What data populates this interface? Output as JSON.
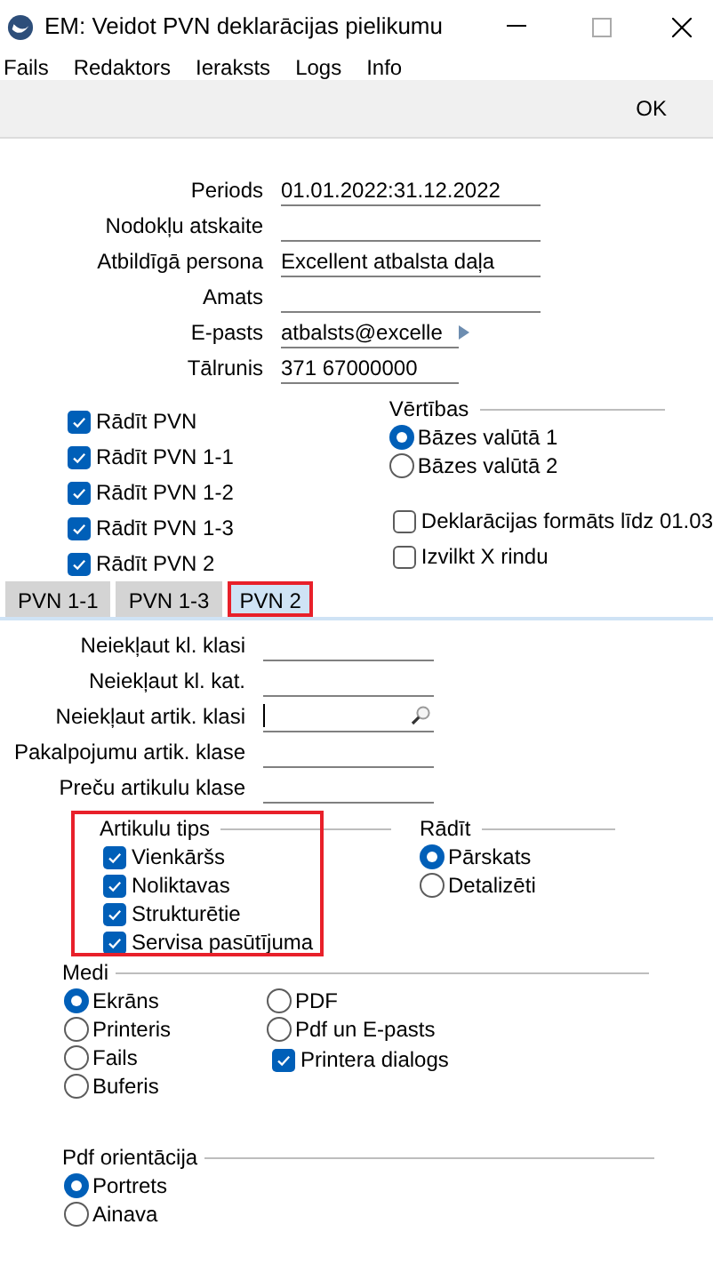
{
  "window": {
    "title": "EM: Veidot PVN deklarācijas pielikumu"
  },
  "menu": [
    "Fails",
    "Redaktors",
    "Ieraksts",
    "Logs",
    "Info"
  ],
  "toolbar": {
    "ok": "OK"
  },
  "fields": [
    {
      "label": "Periods",
      "value": "01.01.2022:31.12.2022",
      "kind": "text"
    },
    {
      "label": "Nodokļu atskaite",
      "kind": "text"
    },
    {
      "label": "Atbildīgā persona",
      "value": "Excellent atbalsta daļa",
      "kind": "text"
    },
    {
      "label": "Amats",
      "kind": "text"
    },
    {
      "label": "E-pasts",
      "value": "atbalsts@excelle",
      "kind": "email"
    },
    {
      "label": "Tālrunis",
      "value": "371 67000000",
      "kind": "phone"
    }
  ],
  "show_checks": [
    {
      "label": "Rādīt PVN",
      "checked": true
    },
    {
      "label": "Rādīt PVN 1-1",
      "checked": true
    },
    {
      "label": "Rādīt PVN 1-2",
      "checked": true
    },
    {
      "label": "Rādīt PVN 1-3",
      "checked": true
    },
    {
      "label": "Rādīt PVN 2",
      "checked": true
    }
  ],
  "values": {
    "label": "Vērtības",
    "options": [
      {
        "label": "Bāzes valūtā 1",
        "selected": true
      },
      {
        "label": "Bāzes valūtā 2",
        "selected": false
      }
    ]
  },
  "options": [
    {
      "label": "Deklarācijas formāts līdz 01.03",
      "checked": false
    },
    {
      "label": "Izvilkt X rindu",
      "checked": false
    }
  ],
  "tabs": [
    {
      "label": "PVN 1-1",
      "selected": false,
      "annotated": false
    },
    {
      "label": "PVN 1-3",
      "selected": false,
      "annotated": false
    },
    {
      "label": "PVN 2",
      "selected": true,
      "annotated": true
    }
  ],
  "tab_fields": [
    {
      "label": "Neiekļaut kl. klasi",
      "kind": "text"
    },
    {
      "label": "Neiekļaut kl. kat.",
      "kind": "text"
    },
    {
      "label": "Neiekļaut artik. klasi",
      "kind": "lookup"
    },
    {
      "label": "Pakalpojumu artik. klase",
      "kind": "text"
    },
    {
      "label": "Preču artikulu klase",
      "kind": "text"
    }
  ],
  "article_types": {
    "label": "Artikulu tips",
    "annotated": true,
    "items": [
      {
        "label": "Vienkāršs",
        "checked": true
      },
      {
        "label": "Noliktavas",
        "checked": true
      },
      {
        "label": "Strukturētie",
        "checked": true
      },
      {
        "label": "Servisa pasūtījuma",
        "checked": true
      }
    ]
  },
  "show": {
    "label": "Rādīt",
    "options": [
      {
        "label": "Pārskats",
        "selected": true
      },
      {
        "label": "Detalizēti",
        "selected": false
      }
    ]
  },
  "media": {
    "label": "Medi",
    "options": [
      {
        "label": "Ekrāns",
        "selected": true
      },
      {
        "label": "Printeris",
        "selected": false
      },
      {
        "label": "Fails",
        "selected": false
      },
      {
        "label": "Buferis",
        "selected": false
      },
      {
        "label": "PDF",
        "selected": false
      },
      {
        "label": "Pdf un E-pasts",
        "selected": false
      }
    ],
    "printer_dialog": {
      "label": "Printera dialogs",
      "checked": true
    }
  },
  "pdf_orientation": {
    "label": "Pdf orientācija",
    "options": [
      {
        "label": "Portrets",
        "selected": true
      },
      {
        "label": "Ainava",
        "selected": false
      }
    ]
  }
}
